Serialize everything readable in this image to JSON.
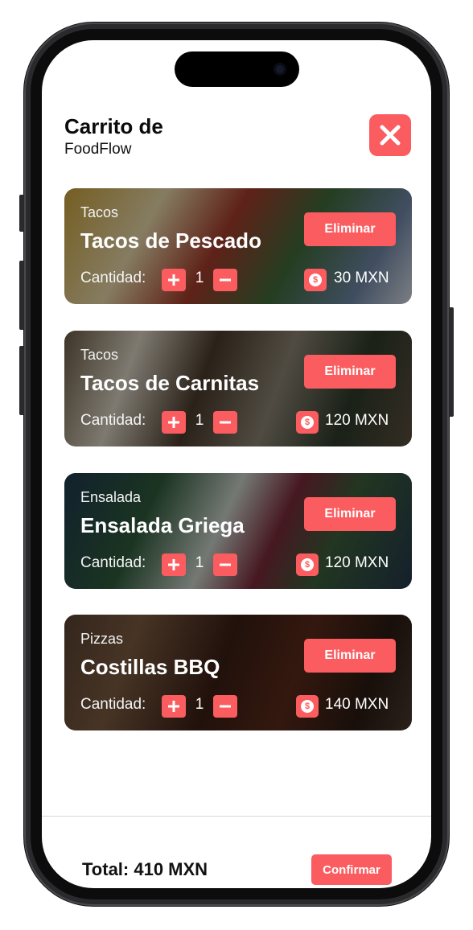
{
  "header": {
    "title": "Carrito de",
    "subtitle": "FoodFlow"
  },
  "quantity_label": "Cantidad:",
  "delete_label": "Eliminar",
  "currency_symbol": "$",
  "items": [
    {
      "category": "Tacos",
      "name": "Tacos de Pescado",
      "quantity": "1",
      "price": "30 MXN"
    },
    {
      "category": "Tacos",
      "name": "Tacos de Carnitas",
      "quantity": "1",
      "price": "120 MXN"
    },
    {
      "category": "Ensalada",
      "name": "Ensalada Griega",
      "quantity": "1",
      "price": "120 MXN"
    },
    {
      "category": "Pizzas",
      "name": "Costillas BBQ",
      "quantity": "1",
      "price": "140 MXN"
    }
  ],
  "footer": {
    "total": "Total: 410 MXN",
    "confirm_label": "Confirmar"
  },
  "colors": {
    "accent": "#fb5c5f"
  }
}
